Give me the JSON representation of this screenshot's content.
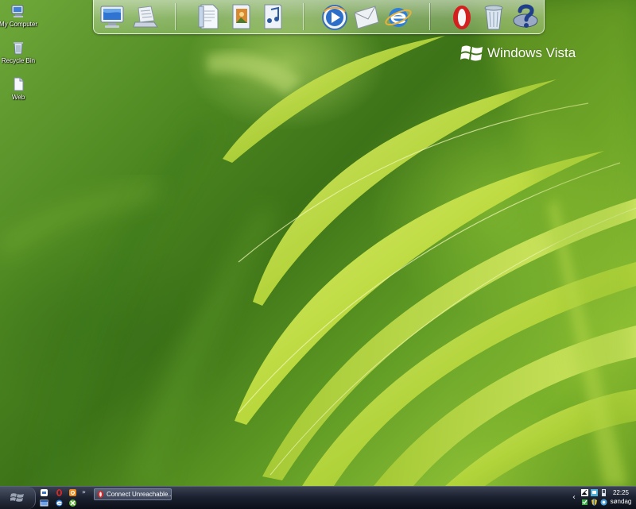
{
  "desktop": {
    "icons": [
      {
        "label": "My Computer",
        "icon": "my-computer-icon"
      },
      {
        "label": "Recycle Bin",
        "icon": "recycle-bin-icon"
      },
      {
        "label": "Web",
        "icon": "web-document-icon"
      }
    ]
  },
  "dock": {
    "items": [
      {
        "name": "computer",
        "icon": "monitor-icon"
      },
      {
        "name": "network-scanner",
        "icon": "scanner-icon"
      },
      {
        "name": "documents",
        "icon": "document-icon"
      },
      {
        "name": "pictures",
        "icon": "pictures-folder-icon"
      },
      {
        "name": "music",
        "icon": "music-folder-icon"
      },
      {
        "name": "media-player",
        "icon": "media-player-icon"
      },
      {
        "name": "mail",
        "icon": "mail-envelope-icon"
      },
      {
        "name": "internet-explorer",
        "icon": "internet-explorer-icon"
      },
      {
        "name": "opera",
        "icon": "opera-icon"
      },
      {
        "name": "recycle-bin",
        "icon": "trash-can-icon"
      },
      {
        "name": "help",
        "icon": "help-question-icon"
      }
    ]
  },
  "branding": {
    "logo_text": "Windows Vista"
  },
  "taskbar": {
    "quick_launch": [
      {
        "name": "show-desktop",
        "icon": "show-desktop-icon"
      },
      {
        "name": "opera",
        "icon": "opera-small-icon"
      },
      {
        "name": "feed",
        "icon": "feed-icon"
      },
      {
        "name": "window-switcher",
        "icon": "window-switcher-icon"
      },
      {
        "name": "internet-explorer",
        "icon": "ie-small-icon"
      },
      {
        "name": "xbox",
        "icon": "xbox-icon"
      }
    ],
    "quick_launch_more": "»",
    "tasks": [
      {
        "label": "Connect Unreachable...",
        "icon": "opera-task-icon"
      }
    ],
    "tray_expand": "‹",
    "tray_icons": [
      {
        "name": "network",
        "icon": "network-tray-icon"
      },
      {
        "name": "display",
        "icon": "display-tray-icon"
      },
      {
        "name": "device",
        "icon": "device-tray-icon"
      },
      {
        "name": "security",
        "icon": "security-tray-icon"
      },
      {
        "name": "shield",
        "icon": "shield-tray-icon"
      },
      {
        "name": "messenger",
        "icon": "messenger-tray-icon"
      }
    ],
    "clock": {
      "time": "22:25",
      "day": "søndag"
    }
  },
  "colors": {
    "taskbar": "#1c2230",
    "wallpaper_base": "#4f8a22",
    "leaf_highlight": "#c8e24a"
  }
}
